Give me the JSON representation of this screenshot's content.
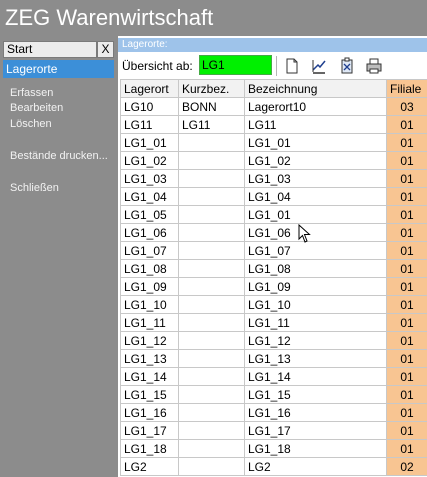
{
  "app": {
    "title": "ZEG Warenwirtschaft"
  },
  "sidebar": {
    "start_tab": "Start",
    "close_label": "X",
    "active_item": "Lagerorte",
    "menu": [
      "Erfassen",
      "Bearbeiten",
      "Löschen",
      "Bestände drucken...",
      "Schließen"
    ]
  },
  "panel": {
    "title": "Lagerorte:"
  },
  "toolbar": {
    "overview_label": "Übersicht ab:",
    "search_value": "LG1",
    "icons": [
      "new-document-icon",
      "edit-icon",
      "delete-icon",
      "print-icon"
    ]
  },
  "table": {
    "columns": [
      "Lagerort",
      "Kurzbez.",
      "Bezeichnung",
      "Filiale"
    ],
    "rows": [
      [
        "LG10",
        "BONN",
        "Lagerort10",
        "03"
      ],
      [
        "LG11",
        "LG11",
        "LG11",
        "01"
      ],
      [
        "LG1_01",
        "",
        "LG1_01",
        "01"
      ],
      [
        "LG1_02",
        "",
        "LG1_02",
        "01"
      ],
      [
        "LG1_03",
        "",
        "LG1_03",
        "01"
      ],
      [
        "LG1_04",
        "",
        "LG1_04",
        "01"
      ],
      [
        "LG1_05",
        "",
        "LG1_01",
        "01"
      ],
      [
        "LG1_06",
        "",
        "LG1_06",
        "01"
      ],
      [
        "LG1_07",
        "",
        "LG1_07",
        "01"
      ],
      [
        "LG1_08",
        "",
        "LG1_08",
        "01"
      ],
      [
        "LG1_09",
        "",
        "LG1_09",
        "01"
      ],
      [
        "LG1_10",
        "",
        "LG1_10",
        "01"
      ],
      [
        "LG1_11",
        "",
        "LG1_11",
        "01"
      ],
      [
        "LG1_12",
        "",
        "LG1_12",
        "01"
      ],
      [
        "LG1_13",
        "",
        "LG1_13",
        "01"
      ],
      [
        "LG1_14",
        "",
        "LG1_14",
        "01"
      ],
      [
        "LG1_15",
        "",
        "LG1_15",
        "01"
      ],
      [
        "LG1_16",
        "",
        "LG1_16",
        "01"
      ],
      [
        "LG1_17",
        "",
        "LG1_17",
        "01"
      ],
      [
        "LG1_18",
        "",
        "LG1_18",
        "01"
      ],
      [
        "LG2",
        "",
        "LG2",
        "02"
      ]
    ]
  },
  "colors": {
    "sidebar_bg": "#8c8c8c",
    "active_item_bg": "#3c8fd8",
    "panel_header_bg": "#9ec3ea",
    "search_bg": "#00f000",
    "filiale_bg": "#f8c592"
  }
}
